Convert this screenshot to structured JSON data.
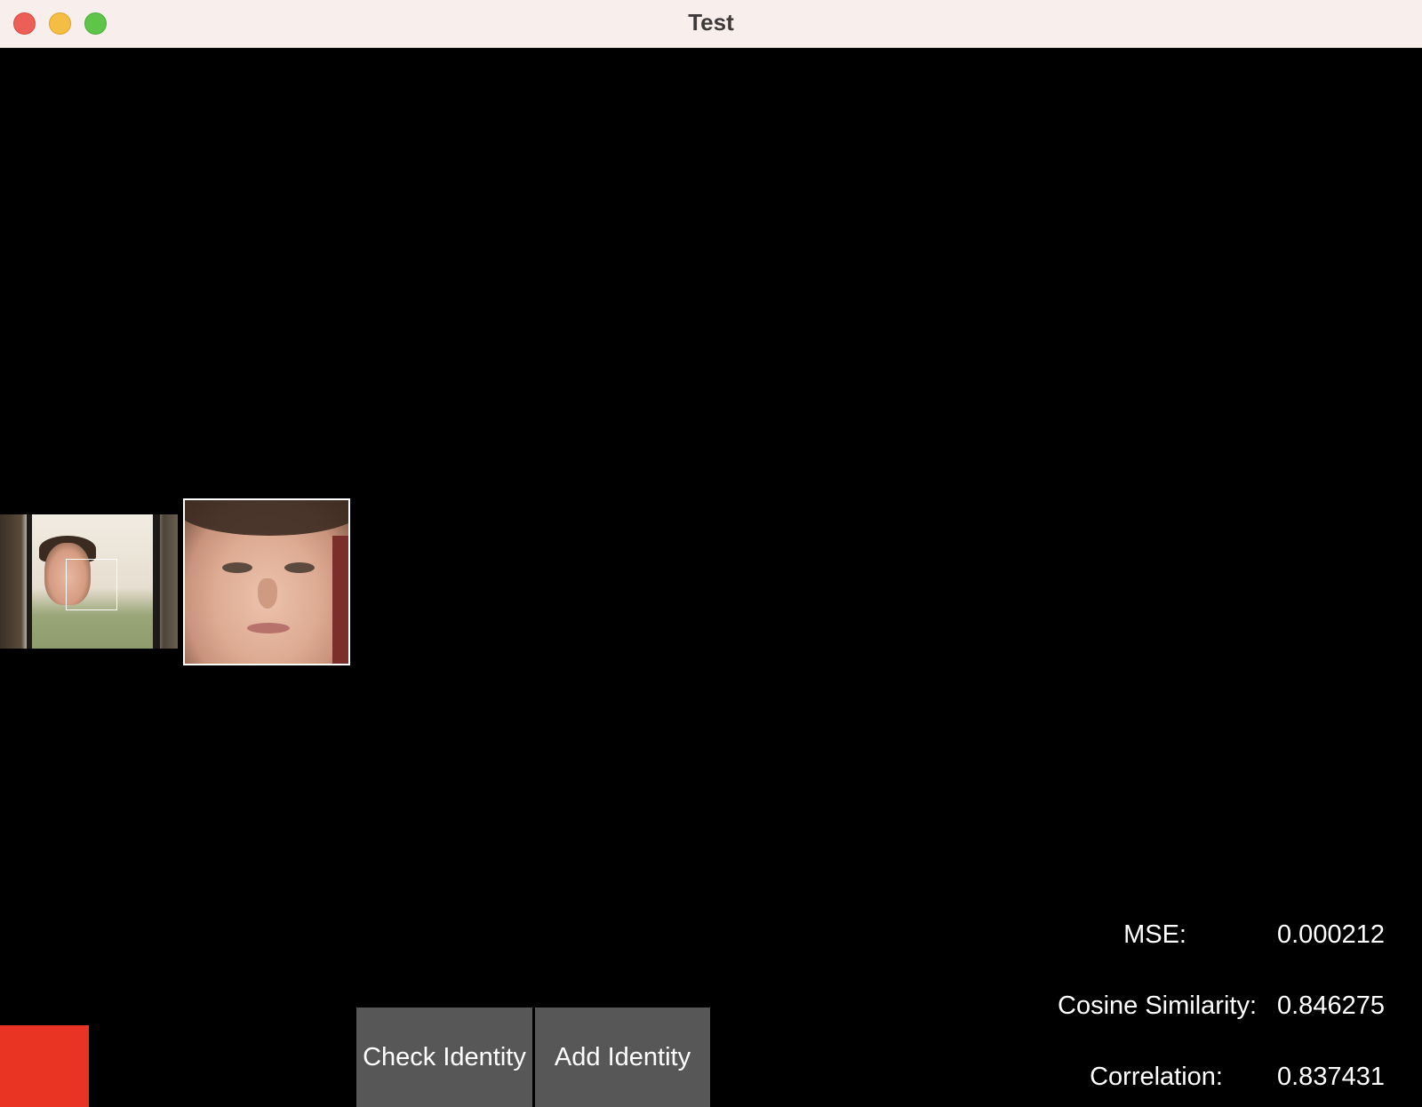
{
  "window": {
    "title": "Test"
  },
  "buttons": {
    "check_identity": "Check Identity",
    "add_identity": "Add Identity"
  },
  "metrics": {
    "mse": {
      "label": "MSE:",
      "value": "0.000212"
    },
    "cosine": {
      "label": "Cosine Similarity:",
      "value": "0.846275"
    },
    "correlation": {
      "label": "Correlation:",
      "value": "0.837431"
    }
  },
  "status": {
    "color": "#e93323"
  }
}
